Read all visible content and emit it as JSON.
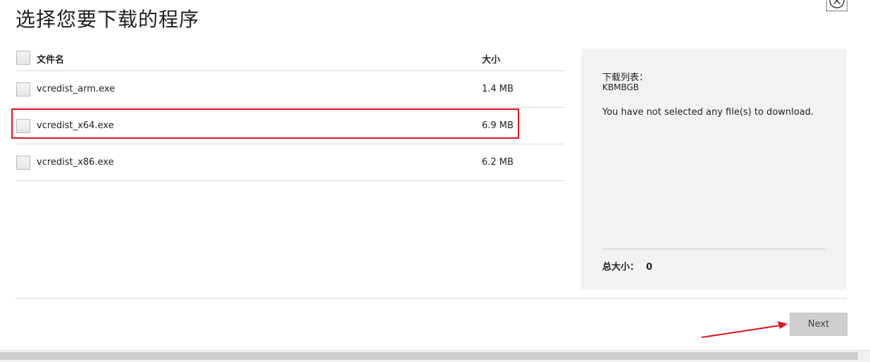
{
  "header": {
    "title": "选择您要下载的程序"
  },
  "file_list": {
    "columns": {
      "name": "文件名",
      "size": "大小"
    },
    "rows": [
      {
        "name": "vcredist_arm.exe",
        "size": "1.4 MB",
        "checked": false
      },
      {
        "name": "vcredist_x64.exe",
        "size": "6.9 MB",
        "checked": false,
        "highlighted": true
      },
      {
        "name": "vcredist_x86.exe",
        "size": "6.2 MB",
        "checked": false
      }
    ]
  },
  "summary": {
    "list_title": "下载列表：",
    "list_code": "KBMBGB",
    "empty_message": "You have not selected any file(s) to download.",
    "total_label": "总大小：",
    "total_value": "0"
  },
  "footer": {
    "next_label": "Next"
  },
  "icons": {
    "close": "close-icon",
    "arrow": "red-arrow-annotation"
  },
  "colors": {
    "highlight": "#e0141c",
    "arrow": "#e0141c",
    "panel_bg": "#f2f2f2",
    "button_bg": "#cfcfcf"
  }
}
